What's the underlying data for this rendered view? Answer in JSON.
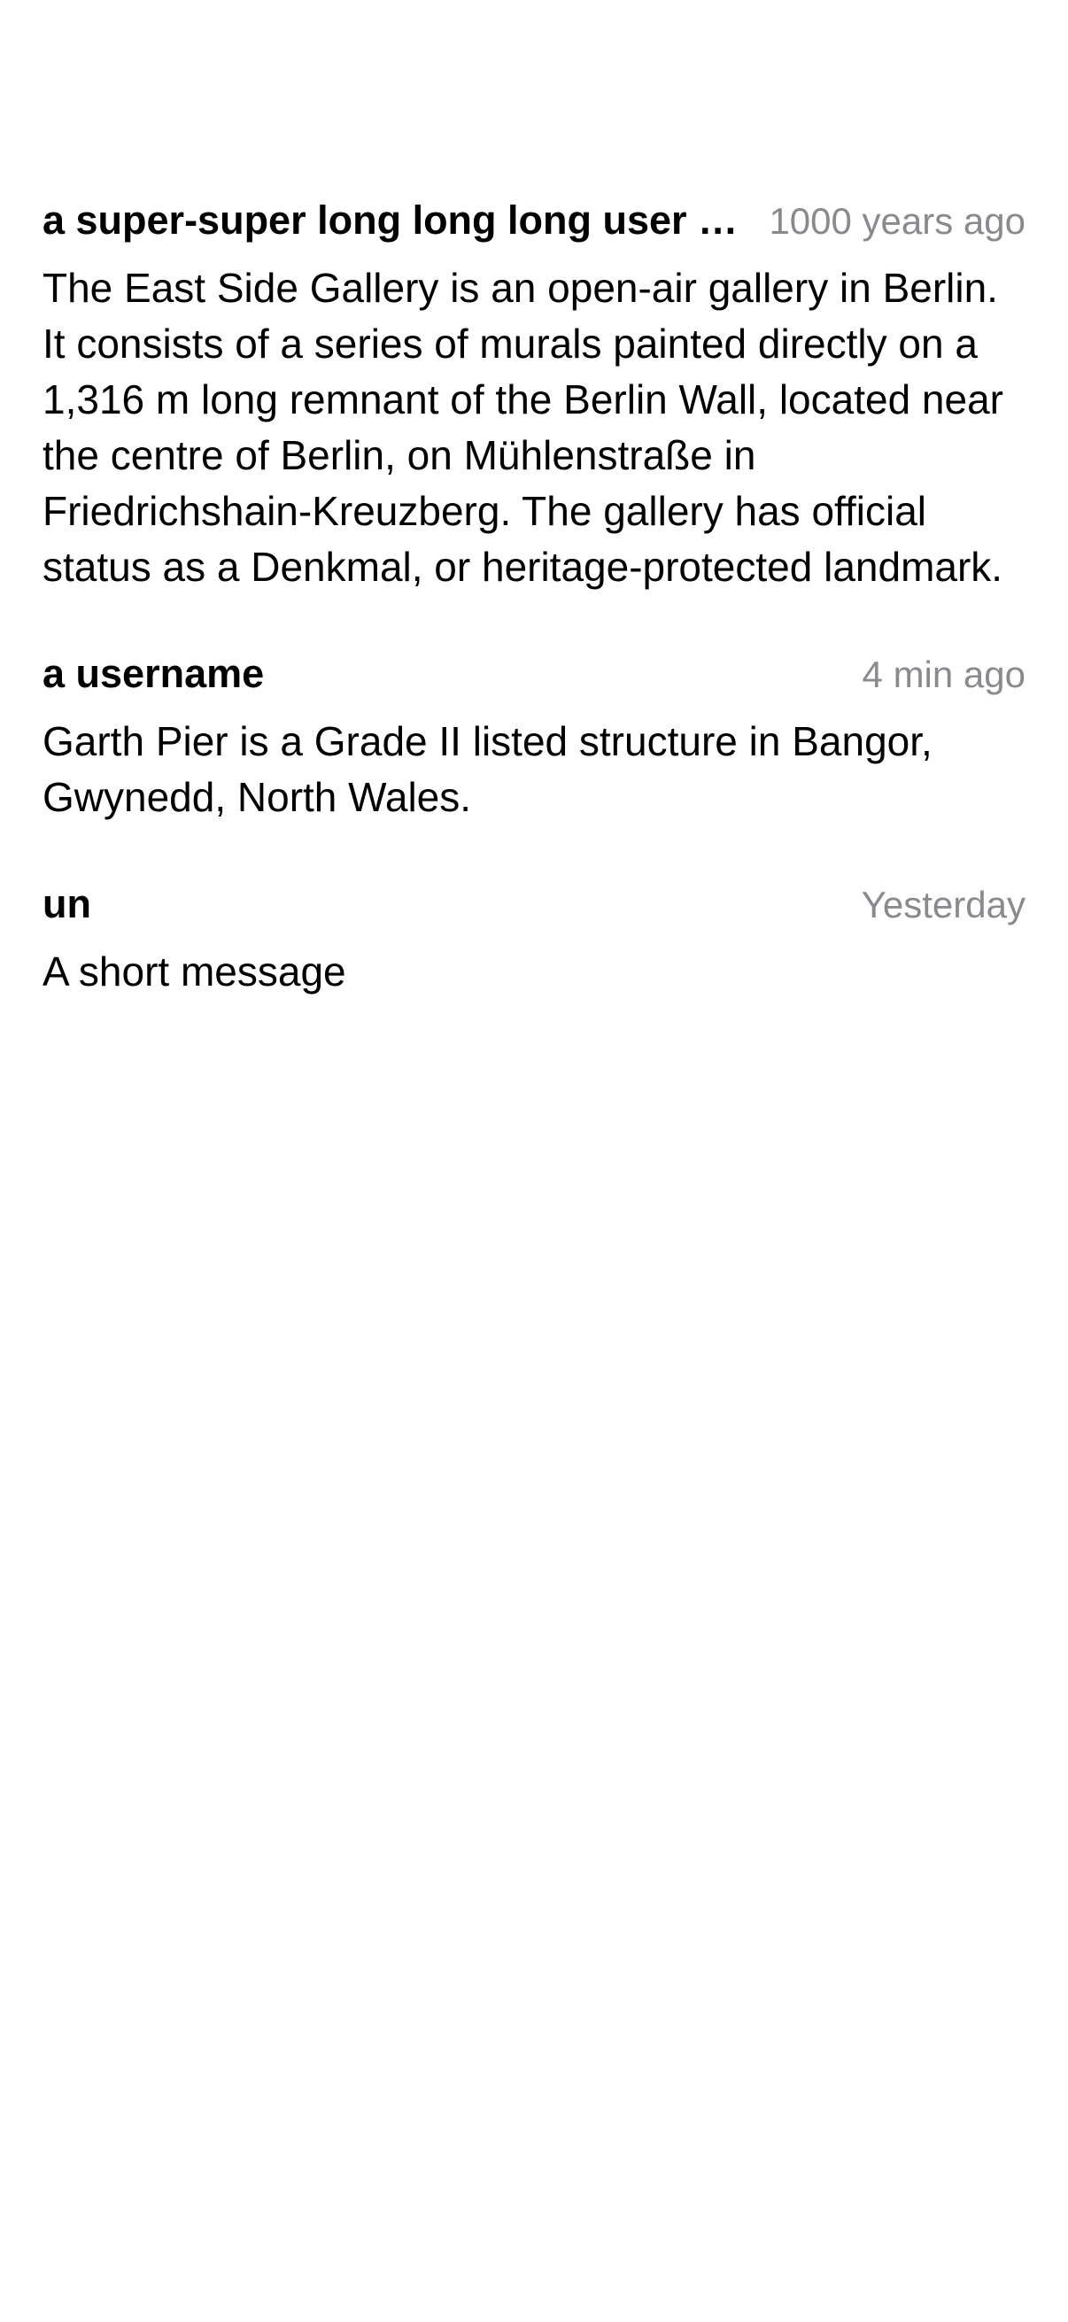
{
  "comments": [
    {
      "username": "a super-super long long long user name",
      "timestamp": "1000 years ago",
      "message": "The East Side Gallery is an open-air gallery in Berlin. It consists of a series of murals painted directly on a 1,316 m long remnant of the Berlin Wall, located near the centre of Berlin, on Mühlenstraße in Friedrichshain-Kreuzberg. The gallery has official status as a Denkmal, or heritage-protected landmark."
    },
    {
      "username": "a username",
      "timestamp": "4 min ago",
      "message": "Garth Pier is a Grade II listed structure in Bangor, Gwynedd, North Wales."
    },
    {
      "username": "un",
      "timestamp": "Yesterday",
      "message": "A short message"
    }
  ],
  "colors": {
    "text": "#000000",
    "secondary_text": "#8a8a8e",
    "background": "#ffffff"
  }
}
